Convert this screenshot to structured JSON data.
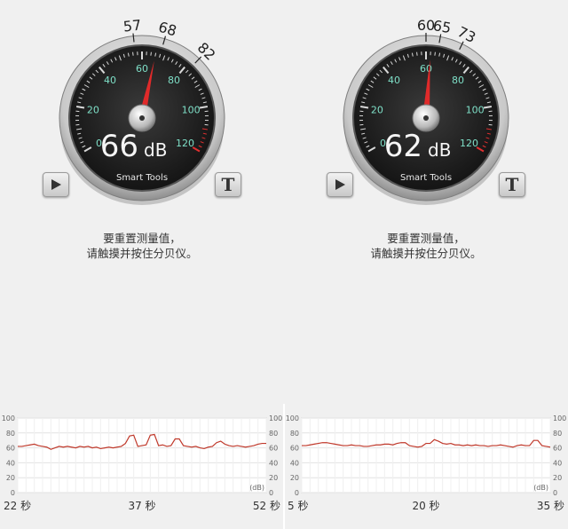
{
  "panels": [
    {
      "id": "left",
      "reading": {
        "value": "66",
        "unit": "dB",
        "needle_db": 66
      },
      "brand": "Smart Tools",
      "markers": [
        "57",
        "68",
        "82"
      ],
      "dial_labels": [
        "0",
        "20",
        "40",
        "60",
        "80",
        "100",
        "120"
      ],
      "instruction_lines": [
        "要重置测量值，",
        "请触摸并按住分贝仪。"
      ],
      "buttons": {
        "play_icon": "play-icon",
        "t_label": "T"
      },
      "history": {
        "y_ticks": [
          "100",
          "80",
          "60",
          "40",
          "20",
          "0"
        ],
        "unit_label": "(dB)",
        "x_labels": [
          "22 秒",
          "37 秒",
          "52 秒"
        ]
      }
    },
    {
      "id": "right",
      "reading": {
        "value": "62",
        "unit": "dB",
        "needle_db": 62
      },
      "brand": "Smart Tools",
      "markers": [
        "60",
        "65",
        "73"
      ],
      "dial_labels": [
        "0",
        "20",
        "40",
        "60",
        "80",
        "100",
        "120"
      ],
      "instruction_lines": [
        "要重置测量值，",
        "请触摸并按住分贝仪。"
      ],
      "buttons": {
        "play_icon": "play-icon",
        "t_label": "T"
      },
      "history": {
        "y_ticks": [
          "100",
          "80",
          "60",
          "40",
          "20",
          "0"
        ],
        "unit_label": "(dB)",
        "x_labels": [
          "5 秒",
          "20 秒",
          "35 秒"
        ]
      }
    }
  ],
  "chart_data": [
    {
      "type": "line",
      "title": "",
      "xlabel": "",
      "ylabel": "(dB)",
      "x_tick_labels": [
        "22 秒",
        "37 秒",
        "52 秒"
      ],
      "ylim": [
        0,
        100
      ],
      "y_ticks": [
        0,
        20,
        40,
        60,
        80,
        100
      ],
      "grid": true,
      "series": [
        {
          "values": [
            62,
            62,
            63,
            64,
            65,
            63,
            62,
            61,
            58,
            60,
            62,
            61,
            62,
            61,
            60,
            62,
            61,
            62,
            60,
            61,
            59,
            60,
            61,
            60,
            61,
            62,
            66,
            76,
            77,
            62,
            63,
            64,
            77,
            78,
            63,
            64,
            62,
            63,
            72,
            72,
            63,
            62,
            61,
            62,
            60,
            59,
            61,
            62,
            67,
            69,
            65,
            63,
            62,
            63,
            62,
            61,
            62,
            63,
            65,
            66,
            66
          ]
        }
      ]
    },
    {
      "type": "line",
      "title": "",
      "xlabel": "",
      "ylabel": "(dB)",
      "x_tick_labels": [
        "5 秒",
        "20 秒",
        "35 秒"
      ],
      "ylim": [
        0,
        100
      ],
      "y_ticks": [
        0,
        20,
        40,
        60,
        80,
        100
      ],
      "grid": true,
      "series": [
        {
          "values": [
            63,
            63,
            64,
            65,
            66,
            67,
            67,
            66,
            65,
            64,
            63,
            63,
            64,
            63,
            63,
            62,
            62,
            63,
            64,
            64,
            65,
            65,
            64,
            66,
            67,
            67,
            63,
            62,
            61,
            62,
            66,
            66,
            71,
            69,
            66,
            65,
            66,
            64,
            64,
            63,
            64,
            63,
            64,
            63,
            63,
            62,
            63,
            63,
            64,
            63,
            62,
            61,
            63,
            64,
            63,
            63,
            70,
            70,
            63,
            62,
            61
          ]
        }
      ]
    }
  ]
}
